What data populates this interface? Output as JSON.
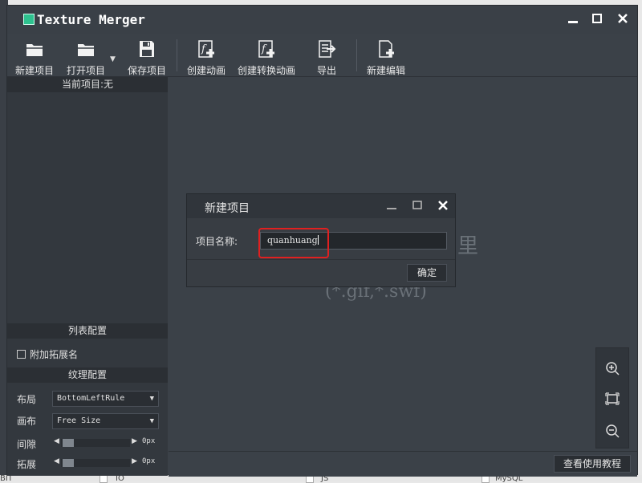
{
  "window": {
    "title": "Texture Merger"
  },
  "toolbar": {
    "new_project": "新建项目",
    "open_project": "打开项目",
    "save_project": "保存项目",
    "create_animation": "创建动画",
    "create_convert_animation": "创建转换动画",
    "export": "导出",
    "new_edit": "新建编辑"
  },
  "left_panel": {
    "current_project": "当前项目:无",
    "list_config": "列表配置",
    "append_extension": "附加拓展名",
    "texture_config": "纹理配置",
    "layout_label": "布局",
    "layout_value": "BottomLeftRule",
    "canvas_label": "画布",
    "canvas_value": "Free Size",
    "gap_label": "间隙",
    "gap_value": "0px",
    "extend_label": "拓展",
    "extend_value": "0px"
  },
  "main": {
    "ghost_text": "里",
    "ghost_hint": "(*.gif,*.swf)"
  },
  "status": {
    "help_button": "查看使用教程"
  },
  "dialog": {
    "title": "新建项目",
    "name_label": "项目名称:",
    "name_value": "quanhuang",
    "ok_button": "确定"
  },
  "background": {
    "items": [
      "BIT",
      "IO",
      "JS",
      "MySQL"
    ]
  },
  "colors": {
    "accent_icon": "#2ec28f",
    "highlight": "#e02020",
    "window_bg": "#3b4148"
  }
}
